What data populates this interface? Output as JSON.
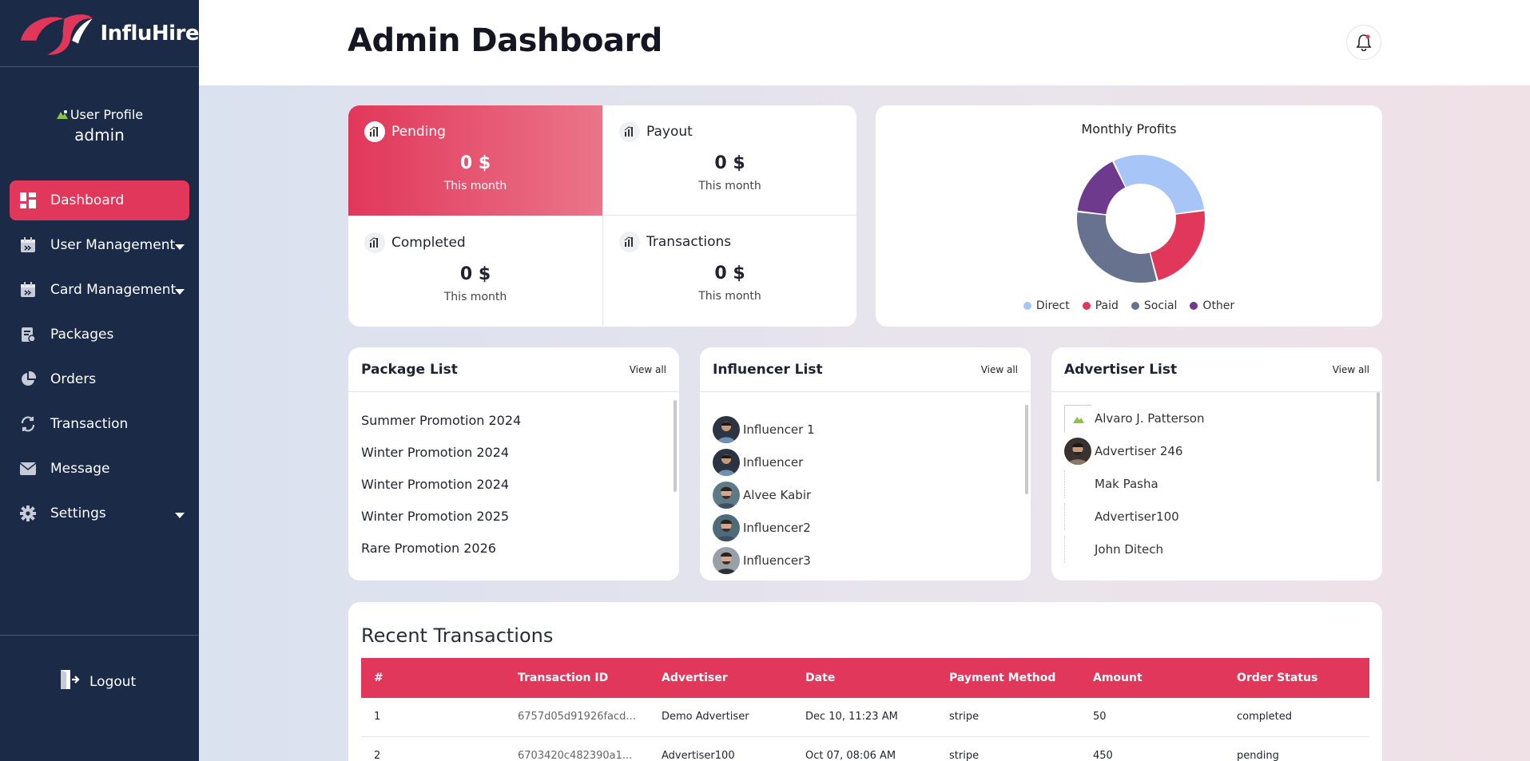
{
  "app": {
    "name": "InfluHire"
  },
  "profile": {
    "image_alt": "User Profile",
    "name": "admin"
  },
  "nav": {
    "items": [
      {
        "label": "Dashboard",
        "icon": "dashboard-icon",
        "active": true
      },
      {
        "label": "User Management",
        "icon": "calendar-icon",
        "has_submenu": true
      },
      {
        "label": "Card Management",
        "icon": "calendar-icon",
        "has_submenu": true
      },
      {
        "label": "Packages",
        "icon": "package-icon"
      },
      {
        "label": "Orders",
        "icon": "pie-chart-icon"
      },
      {
        "label": "Transaction",
        "icon": "exchange-icon"
      },
      {
        "label": "Message",
        "icon": "mail-icon"
      },
      {
        "label": "Settings",
        "icon": "gear-icon",
        "has_submenu": true
      }
    ],
    "logout": "Logout"
  },
  "header": {
    "title": "Admin Dashboard",
    "bell_icon": "bell-icon"
  },
  "stats": [
    {
      "label": "Pending",
      "value": "0 $",
      "sub": "This month"
    },
    {
      "label": "Payout",
      "value": "0 $",
      "sub": "This month"
    },
    {
      "label": "Completed",
      "value": "0 $",
      "sub": "This month"
    },
    {
      "label": "Transactions",
      "value": "0 $",
      "sub": "This month"
    }
  ],
  "profits": {
    "title": "Monthly Profits",
    "legend": [
      {
        "label": "Direct",
        "color": "#a8c5f8",
        "share": 0.3
      },
      {
        "label": "Paid",
        "color": "#e1375a",
        "share": 0.23
      },
      {
        "label": "Social",
        "color": "#66728e",
        "share": 0.31
      },
      {
        "label": "Other",
        "color": "#6e3a8e",
        "share": 0.16
      }
    ]
  },
  "package_list": {
    "title": "Package List",
    "view_all": "View all",
    "items": [
      "Summer Promotion 2024",
      "Winter Promotion 2024",
      "Winter Promotion 2024",
      "Winter Promotion 2025",
      "Rare Promotion 2026"
    ]
  },
  "influencer_list": {
    "title": "Influencer List",
    "view_all": "View all",
    "items": [
      "Influencer 1",
      "Influencer",
      "Alvee Kabir",
      "Influencer2",
      "Influencer3"
    ]
  },
  "advertiser_list": {
    "title": "Advertiser List",
    "view_all": "View all",
    "items": [
      "Alvaro J. Patterson",
      "Advertiser 246",
      "Mak Pasha",
      "Advertiser100",
      "John Ditech"
    ]
  },
  "transactions": {
    "title": "Recent Transactions",
    "columns": [
      "#",
      "Transaction ID",
      "Advertiser",
      "Date",
      "Payment Method",
      "Amount",
      "Order Status"
    ],
    "rows": [
      [
        "1",
        "6757d05d91926facd...",
        "Demo Advertiser",
        "Dec 10, 11:23 AM",
        "stripe",
        "50",
        "completed"
      ],
      [
        "2",
        "6703420c482390a1...",
        "Advertiser100",
        "Oct 07, 08:06 AM",
        "stripe",
        "450",
        "pending"
      ]
    ]
  },
  "colors": {
    "sidebar": "#1b2a47",
    "accent": "#e1375a"
  }
}
